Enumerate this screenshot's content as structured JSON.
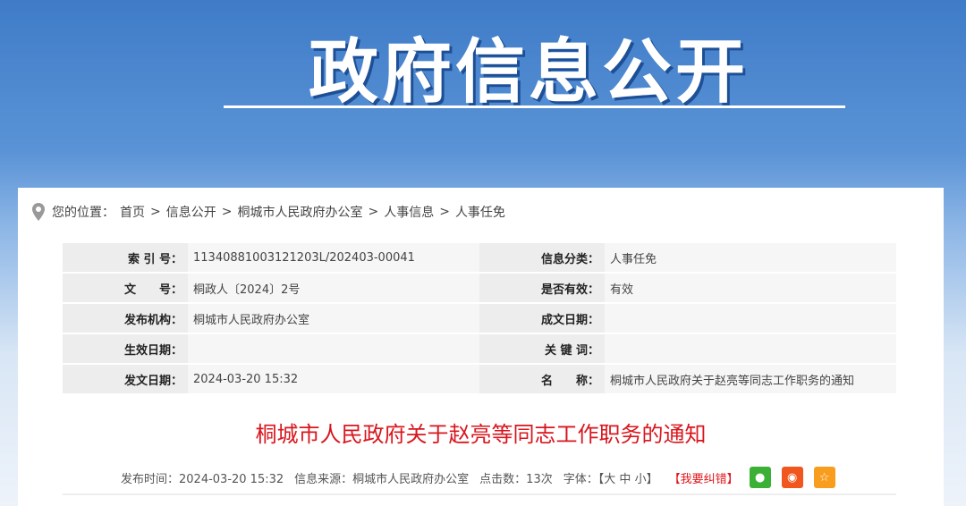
{
  "banner": {
    "title": "政府信息公开"
  },
  "breadcrumb": {
    "prefix": "您的位置：",
    "items": [
      "首页",
      "信息公开",
      "桐城市人民政府办公室",
      "人事信息",
      "人事任免"
    ],
    "sep": ">"
  },
  "info": [
    [
      {
        "k": "索 引 号：",
        "v": "11340881003121203L/202403-00041"
      },
      {
        "k": "信息分类：",
        "v": "人事任免"
      }
    ],
    [
      {
        "k": "文　　号：",
        "v": "桐政人〔2024〕2号"
      },
      {
        "k": "是否有效：",
        "v": "有效"
      }
    ],
    [
      {
        "k": "发布机构：",
        "v": "桐城市人民政府办公室"
      },
      {
        "k": "成文日期：",
        "v": ""
      }
    ],
    [
      {
        "k": "生效日期：",
        "v": ""
      },
      {
        "k": "关 键 词：",
        "v": ""
      }
    ],
    [
      {
        "k": "发文日期：",
        "v": "2024-03-20 15:32"
      },
      {
        "k": "名　　称：",
        "v": "桐城市人民政府关于赵亮等同志工作职务的通知"
      }
    ]
  ],
  "article": {
    "title": "桐城市人民政府关于赵亮等同志工作职务的通知"
  },
  "meta": {
    "publish": "发布时间：2024-03-20 15:32",
    "source": "信息来源：桐城市人民政府办公室",
    "clicks": "点击数：13次",
    "font_label": "字体：",
    "font_open": "【",
    "font_large": "大",
    "font_medium": "中",
    "font_small": "小",
    "font_close": "】",
    "report": "【我要纠错】"
  },
  "colors": {
    "wechat": "#3cb034",
    "weibo": "#f0561d",
    "fav": "#f89d1e",
    "title": "#d9161d"
  }
}
